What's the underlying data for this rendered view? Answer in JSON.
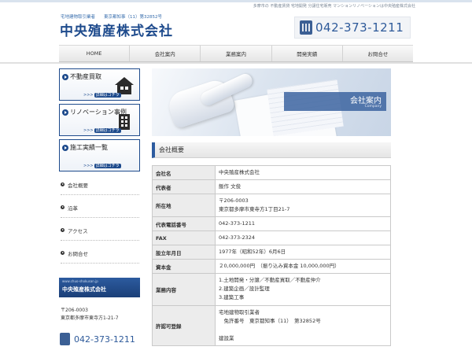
{
  "header": {
    "tagline": "多摩市の 不動産賃貸 宅地開発 分譲住宅販売 マンションリノベーションは中央殖産株式会社",
    "license": "宅地建物取引業者　　東京都知事（11）第32852号",
    "logo": "中央殖産株式会社",
    "phone": "042-373-1211"
  },
  "nav": {
    "items": [
      "HOME",
      "会社案内",
      "業務案内",
      "開発実績",
      "お問合せ"
    ]
  },
  "sidebar": {
    "banners": [
      {
        "title": "不動産買取",
        "more": ">>>",
        "more_tag": "詳細はコチラ"
      },
      {
        "title": "リノベーション事例",
        "more": ">>>",
        "more_tag": "詳細はコチラ"
      },
      {
        "title": "施工実績一覧",
        "more": ">>>",
        "more_tag": "詳細はコチラ"
      }
    ],
    "links": [
      "会社概要",
      "沿革",
      "アクセス",
      "お問合せ"
    ],
    "card": {
      "url": "www.chuo-shokusan.jp",
      "name": "中央殖産株式会社"
    },
    "address": [
      "〒206-0003",
      "東京都多摩市東寺方1-21-7"
    ],
    "phone": "042-373-1211"
  },
  "hero": {
    "title": "会社案内",
    "subtitle": "Company"
  },
  "section": {
    "title": "会社概要"
  },
  "company_table": {
    "rows": [
      {
        "label": "会社名",
        "lines": [
          "中央殖産株式会社"
        ]
      },
      {
        "label": "代表者",
        "lines": [
          "飯作 文俊"
        ]
      },
      {
        "label": "所在地",
        "lines": [
          "〒206-0003",
          "東京都多摩市東寺方1丁目21-7"
        ]
      },
      {
        "label": "代表電話番号",
        "lines": [
          "042-373-1211"
        ]
      },
      {
        "label": "FAX",
        "lines": [
          "042-373-2324"
        ]
      },
      {
        "label": "設立年月日",
        "lines": [
          "1977年（昭和52年）6月6日"
        ]
      },
      {
        "label": "資本金",
        "lines": [
          "２0,000,000円　（振り込み資本金 10,000,000円）"
        ]
      },
      {
        "label": "業務内容",
        "lines": [
          "1.土地開発・分譲／不動産買取／不動産仲介",
          "2.建築企画／設計監理",
          "3.建築工事"
        ]
      },
      {
        "label": "許認可登録",
        "lines": [
          "宅地建物取引業者",
          "　免許番号　東京都知事（11）　第32852号",
          "",
          "建設業"
        ]
      }
    ]
  }
}
